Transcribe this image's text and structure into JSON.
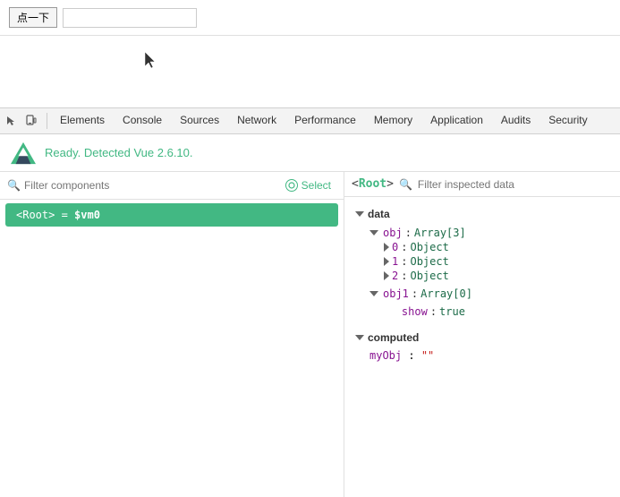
{
  "topBar": {
    "buttonLabel": "点一下",
    "inputPlaceholder": ""
  },
  "devtoolsTabs": {
    "icons": [
      "cursor-icon",
      "device-icon"
    ],
    "tabs": [
      {
        "label": "Elements",
        "active": false
      },
      {
        "label": "Console",
        "active": false
      },
      {
        "label": "Sources",
        "active": false
      },
      {
        "label": "Network",
        "active": false
      },
      {
        "label": "Performance",
        "active": false
      },
      {
        "label": "Memory",
        "active": false
      },
      {
        "label": "Application",
        "active": false
      },
      {
        "label": "Audits",
        "active": false
      },
      {
        "label": "Security",
        "active": false
      }
    ]
  },
  "vueBanner": {
    "readyText": "Ready. Detected Vue 2.6.10."
  },
  "leftPanel": {
    "filterPlaceholder": "Filter components",
    "selectLabel": "Select",
    "componentItem": {
      "tag": "<Root>",
      "equals": "=",
      "varName": "$vm0"
    }
  },
  "rightPanel": {
    "rootTag": "<Root>",
    "filterPlaceholder": "Filter inspected data",
    "sections": {
      "data": {
        "label": "data",
        "nodes": [
          {
            "key": "obj",
            "value": "Array[3]",
            "children": [
              {
                "key": "0",
                "value": "Object"
              },
              {
                "key": "1",
                "value": "Object"
              },
              {
                "key": "2",
                "value": "Object"
              }
            ]
          },
          {
            "key": "obj1",
            "value": "Array[0]"
          },
          {
            "key": "show",
            "value": "true",
            "valueType": "bool"
          }
        ]
      },
      "computed": {
        "label": "computed",
        "nodes": [
          {
            "key": "myObj",
            "value": "\"\"",
            "valueType": "string"
          }
        ]
      }
    }
  }
}
